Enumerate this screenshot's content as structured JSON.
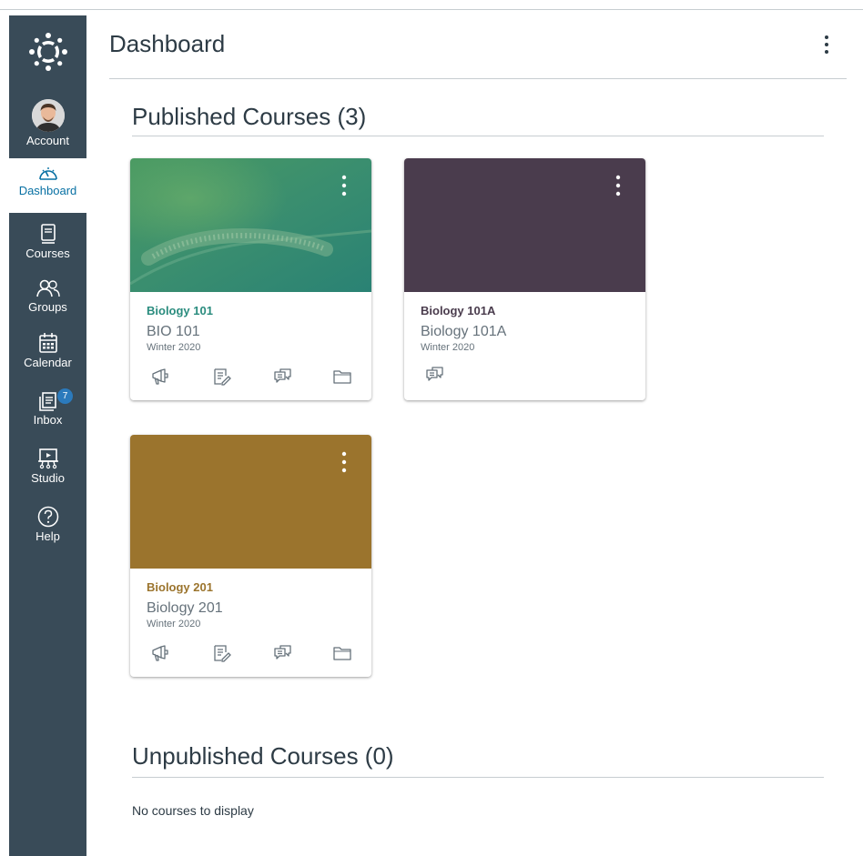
{
  "nav": {
    "account": "Account",
    "dashboard": "Dashboard",
    "courses": "Courses",
    "groups": "Groups",
    "calendar": "Calendar",
    "inbox": "Inbox",
    "inbox_badge": "7",
    "studio": "Studio",
    "help": "Help"
  },
  "header": {
    "title": "Dashboard"
  },
  "published": {
    "title": "Published Courses (3)",
    "cards": [
      {
        "name": "Biology 101",
        "code": "BIO 101",
        "term": "Winter 2020",
        "color": "#2a8c7e",
        "icons": [
          "announcements-icon",
          "assignments-icon",
          "discussions-icon",
          "files-icon"
        ]
      },
      {
        "name": "Biology 101A",
        "code": "Biology 101A",
        "term": "Winter 2020",
        "color": "#4a3c4d",
        "icons": [
          "discussions-icon"
        ]
      },
      {
        "name": "Biology 201",
        "code": "Biology 201",
        "term": "Winter 2020",
        "color": "#9b742d",
        "icons": [
          "announcements-icon",
          "assignments-icon",
          "discussions-icon",
          "files-icon"
        ]
      }
    ]
  },
  "unpublished": {
    "title": "Unpublished Courses (0)",
    "empty": "No courses to display"
  }
}
